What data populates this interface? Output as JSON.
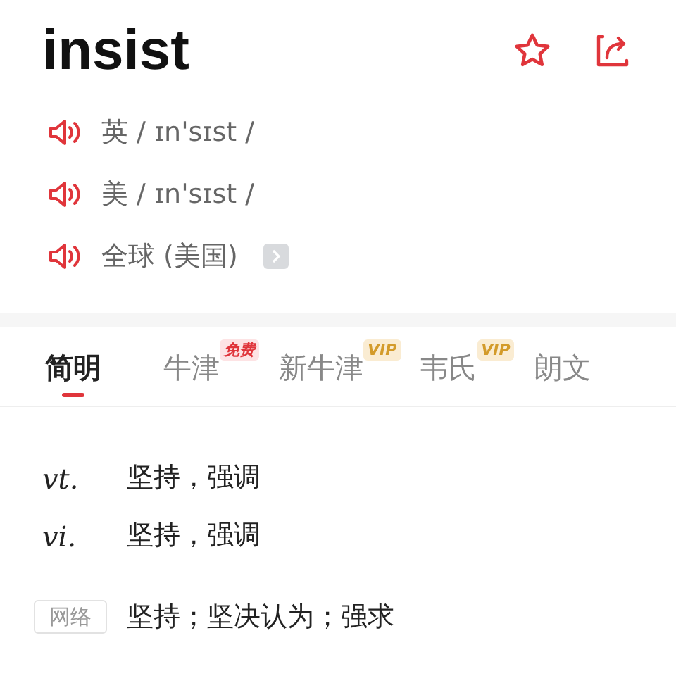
{
  "word": "insist",
  "pronunciations": [
    {
      "label": "英 / ɪn'sɪst /",
      "more": false
    },
    {
      "label": "美 / ɪn'sɪst /",
      "more": false
    },
    {
      "label": "全球 (美国)",
      "more": true
    }
  ],
  "tabs": [
    {
      "label": "简明",
      "selected": true
    },
    {
      "label": "牛津",
      "selected": false,
      "badge": {
        "text": "免费",
        "kind": "free"
      }
    },
    {
      "label": "新牛津",
      "selected": false,
      "badge": {
        "text": "VIP",
        "kind": "vip"
      }
    },
    {
      "label": "韦氏",
      "selected": false,
      "badge": {
        "text": "VIP",
        "kind": "vip"
      }
    },
    {
      "label": "朗文",
      "selected": false
    }
  ],
  "definitions": [
    {
      "kind": "pos",
      "pos": "vt.",
      "text": "坚持，强调"
    },
    {
      "kind": "pos",
      "pos": "vi.",
      "text": "坚持，强调"
    },
    {
      "kind": "tag",
      "pos": "网络",
      "text": "坚持；坚决认为；强求"
    }
  ]
}
